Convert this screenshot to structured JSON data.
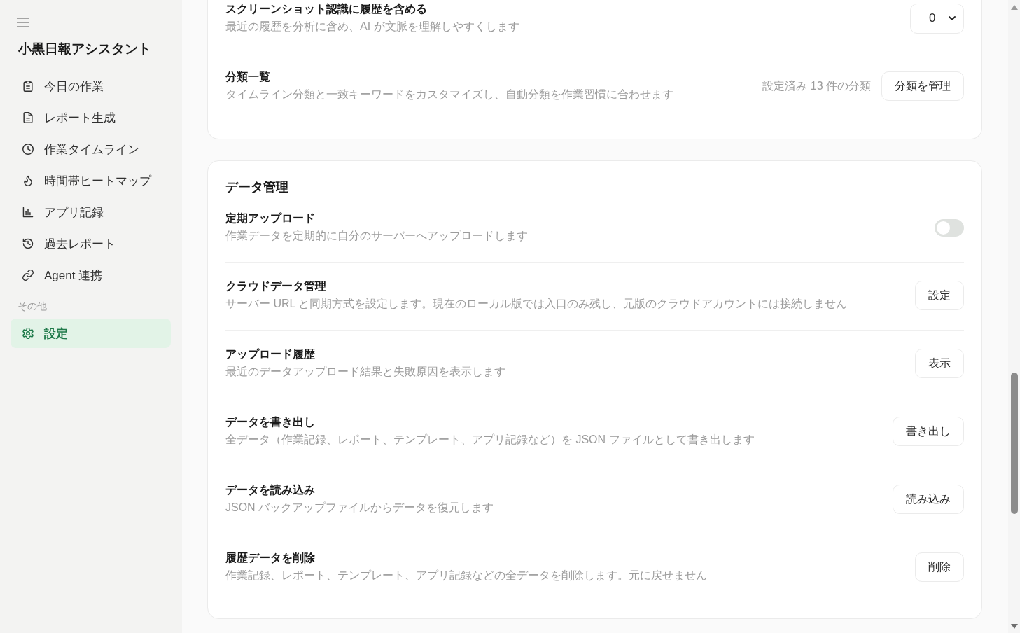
{
  "sidebar": {
    "app_title": "小黒日報アシスタント",
    "nav_items": [
      {
        "label": "今日の作業",
        "selected": false
      },
      {
        "label": "レポート生成",
        "selected": false
      },
      {
        "label": "作業タイムライン",
        "selected": false
      },
      {
        "label": "時間帯ヒートマップ",
        "selected": false
      },
      {
        "label": "アプリ記録",
        "selected": false
      },
      {
        "label": "過去レポート",
        "selected": false
      },
      {
        "label": "Agent 連携",
        "selected": false
      }
    ],
    "section_label": "その他",
    "other_items": [
      {
        "label": "設定",
        "selected": true
      }
    ]
  },
  "settings_sections": [
    {
      "rows": [
        {
          "kind": "select",
          "title": "スクリーンショット認識に履歴を含める",
          "description": "最近の履歴を分析に含め、AI が文脈を理解しやすくします",
          "value": "0"
        },
        {
          "kind": "button",
          "title": "分類一覧",
          "description": "タイムライン分類と一致キーワードをカスタマイズし、自動分類を作業習慣に合わせます",
          "note": "設定済み 13 件の分類",
          "button": "分類を管理"
        }
      ]
    },
    {
      "title": "データ管理",
      "rows": [
        {
          "kind": "toggle",
          "title": "定期アップロード",
          "description": "作業データを定期的に自分のサーバーへアップロードします",
          "on": false
        },
        {
          "kind": "button",
          "title": "クラウドデータ管理",
          "description": "サーバー URL と同期方式を設定します。現在のローカル版では入口のみ残し、元版のクラウドアカウントには接続しません",
          "button": "設定"
        },
        {
          "kind": "button",
          "title": "アップロード履歴",
          "description": "最近のデータアップロード結果と失敗原因を表示します",
          "button": "表示"
        },
        {
          "kind": "button",
          "title": "データを書き出し",
          "description": "全データ（作業記録、レポート、テンプレート、アプリ記録など）を JSON ファイルとして書き出します",
          "button": "書き出し"
        },
        {
          "kind": "button",
          "title": "データを読み込み",
          "description": "JSON バックアップファイルからデータを復元します",
          "button": "読み込み"
        },
        {
          "kind": "button",
          "title": "履歴データを削除",
          "description": "作業記録、レポート、テンプレート、アプリ記録などの全データを削除します。元に戻せません",
          "button": "削除"
        }
      ]
    }
  ]
}
